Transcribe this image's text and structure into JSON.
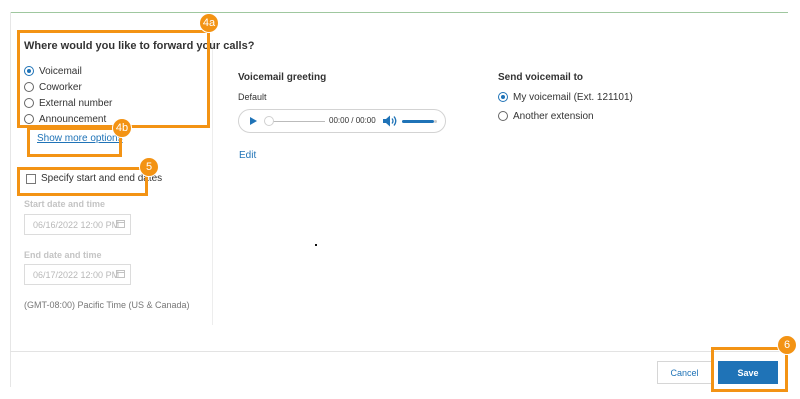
{
  "forward": {
    "question": "Where would you like to forward your calls?",
    "options": [
      {
        "label": "Voicemail",
        "selected": true
      },
      {
        "label": "Coworker",
        "selected": false
      },
      {
        "label": "External number",
        "selected": false
      },
      {
        "label": "Announcement",
        "selected": false
      }
    ],
    "show_more": "Show more options"
  },
  "schedule": {
    "checkbox_label": "Specify start and end dates",
    "checked": false,
    "start_label": "Start date and time",
    "start_value": "06/16/2022 12:00 PM",
    "end_label": "End date and time",
    "end_value": "06/17/2022 12:00 PM",
    "timezone": "(GMT-08:00) Pacific Time (US & Canada)"
  },
  "greeting": {
    "title": "Voicemail greeting",
    "type": "Default",
    "time": "00:00 / 00:00",
    "edit": "Edit"
  },
  "send_to": {
    "title": "Send voicemail to",
    "options": [
      {
        "label": "My voicemail (Ext. 121101)",
        "selected": true
      },
      {
        "label": "Another extension",
        "selected": false
      }
    ]
  },
  "footer": {
    "cancel": "Cancel",
    "save": "Save"
  },
  "callouts": [
    "4a",
    "4b",
    "5",
    "6"
  ],
  "colors": {
    "accent": "#1f73b7",
    "callout": "#f39314"
  }
}
